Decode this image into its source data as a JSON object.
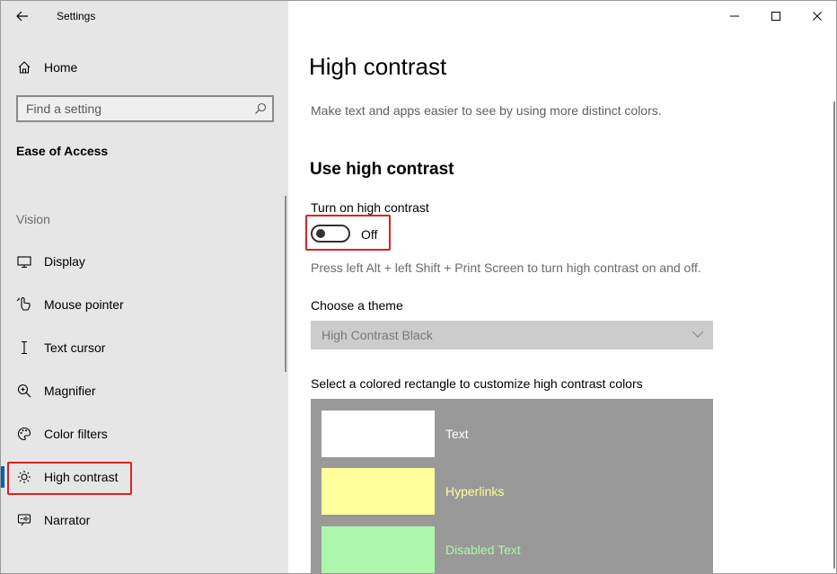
{
  "window": {
    "title": "Settings"
  },
  "sidebar": {
    "home_label": "Home",
    "search_placeholder": "Find a setting",
    "section_title": "Ease of Access",
    "group_label": "Vision",
    "items": [
      {
        "label": "Display",
        "icon": "monitor-icon"
      },
      {
        "label": "Mouse pointer",
        "icon": "mouse-pointer-icon"
      },
      {
        "label": "Text cursor",
        "icon": "text-cursor-icon"
      },
      {
        "label": "Magnifier",
        "icon": "magnifier-icon"
      },
      {
        "label": "Color filters",
        "icon": "color-filters-icon"
      },
      {
        "label": "High contrast",
        "icon": "sun-icon",
        "active": true
      },
      {
        "label": "Narrator",
        "icon": "narrator-icon"
      }
    ]
  },
  "main": {
    "title": "High contrast",
    "description": "Make text and apps easier to see by using more distinct colors.",
    "section_heading": "Use high contrast",
    "toggle_label": "Turn on high contrast",
    "toggle_state": "Off",
    "hint": "Press left Alt + left Shift + Print Screen to turn high contrast on and off.",
    "theme_label": "Choose a theme",
    "theme_value": "High Contrast Black",
    "colors_label": "Select a colored rectangle to customize high contrast colors",
    "swatches": [
      {
        "label": "Text",
        "color": "#ffffff",
        "text_color": "#ffffff"
      },
      {
        "label": "Hyperlinks",
        "color": "#ffff99",
        "text_color": "#ffff99"
      },
      {
        "label": "Disabled Text",
        "color": "#adf7ad",
        "text_color": "#adf7ad"
      }
    ]
  },
  "colors": {
    "accent": "#0063b1",
    "highlight_annotation": "#e02020"
  }
}
